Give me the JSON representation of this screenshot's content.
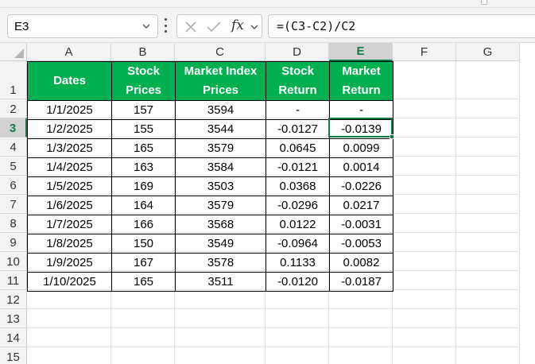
{
  "formula_bar": {
    "name_box": "E3",
    "fx_label": "fx",
    "formula": "=(C3-C2)/C2"
  },
  "columns": [
    "A",
    "B",
    "C",
    "D",
    "E",
    "F",
    "G"
  ],
  "rows": [
    "1",
    "2",
    "3",
    "4",
    "5",
    "6",
    "7",
    "8",
    "9",
    "10",
    "11",
    "12",
    "13",
    "14",
    "15"
  ],
  "selection": {
    "cell": "E3",
    "column": "E",
    "row": "3"
  },
  "table": {
    "header_color": "#00b050",
    "headers": [
      [
        "Dates"
      ],
      [
        "Stock",
        "Prices"
      ],
      [
        "Market Index",
        "Prices"
      ],
      [
        "Stock",
        "Return"
      ],
      [
        "Market",
        "Return"
      ]
    ],
    "rows": [
      [
        "1/1/2025",
        "157",
        "3594",
        "-",
        "-"
      ],
      [
        "1/2/2025",
        "155",
        "3544",
        "-0.0127",
        "-0.0139"
      ],
      [
        "1/3/2025",
        "165",
        "3579",
        "0.0645",
        "0.0099"
      ],
      [
        "1/4/2025",
        "163",
        "3584",
        "-0.0121",
        "0.0014"
      ],
      [
        "1/5/2025",
        "169",
        "3503",
        "0.0368",
        "-0.0226"
      ],
      [
        "1/6/2025",
        "164",
        "3579",
        "-0.0296",
        "0.0217"
      ],
      [
        "1/7/2025",
        "166",
        "3568",
        "0.0122",
        "-0.0031"
      ],
      [
        "1/8/2025",
        "150",
        "3549",
        "-0.0964",
        "-0.0053"
      ],
      [
        "1/9/2025",
        "167",
        "3578",
        "0.1133",
        "0.0082"
      ],
      [
        "1/10/2025",
        "165",
        "3511",
        "-0.0120",
        "-0.0187"
      ]
    ]
  }
}
